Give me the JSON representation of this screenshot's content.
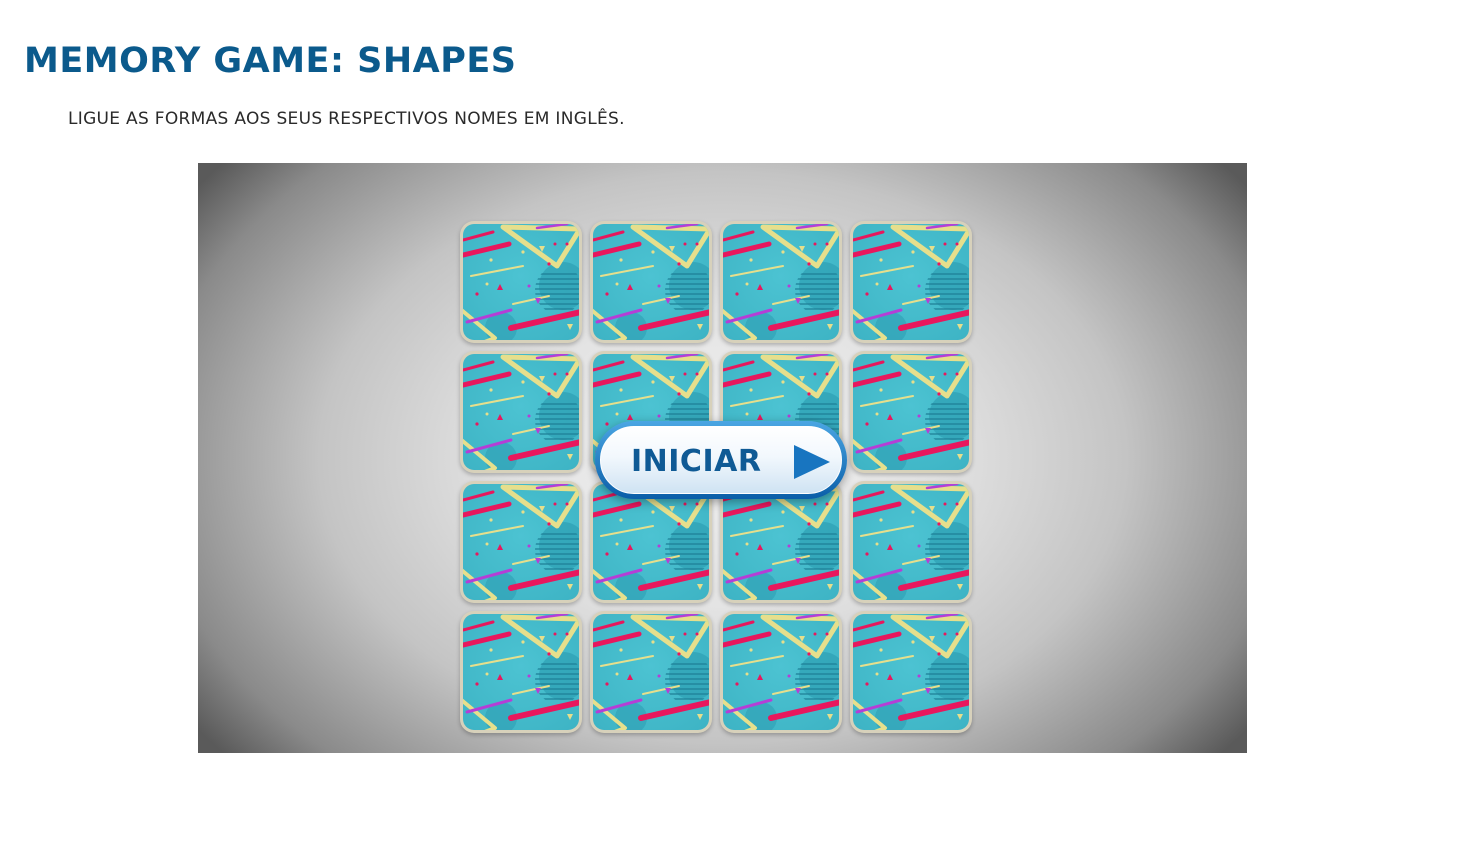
{
  "header": {
    "title": "MEMORY GAME: SHAPES",
    "instructions": "LIGUE AS FORMAS AOS SEUS RESPECTIVOS NOMES EM INGLÊS."
  },
  "game": {
    "start_button_label": "INICIAR",
    "start_button_icon": "play-icon",
    "grid_rows": 4,
    "grid_columns": 4,
    "card_state": "face-down",
    "colors": {
      "title": "#0b5a8c",
      "card_back": "#3db3c4",
      "button_text": "#0f5a95",
      "play_icon": "#1875c0"
    }
  }
}
